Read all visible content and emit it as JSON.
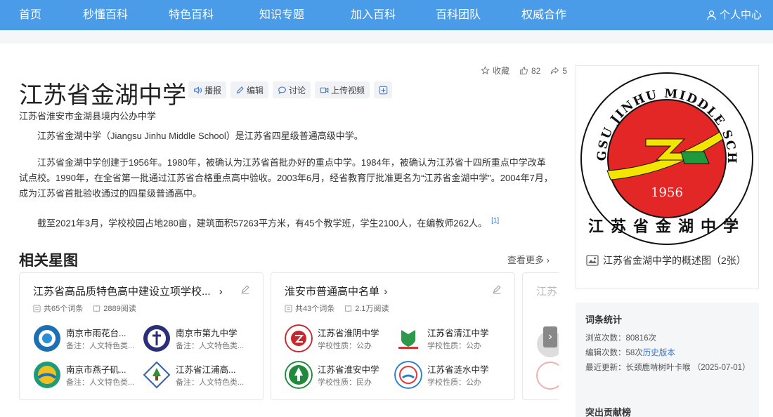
{
  "nav": {
    "items": [
      "首页",
      "秒懂百科",
      "特色百科",
      "知识专题",
      "加入百科",
      "百科团队",
      "权威合作"
    ],
    "user_center": "个人中心"
  },
  "stats": {
    "collect": "收藏",
    "likes": "82",
    "shares": "5"
  },
  "title": "江苏省金湖中学",
  "tools": {
    "broadcast": "播报",
    "edit": "编辑",
    "discuss": "讨论",
    "upload_video": "上传视频"
  },
  "subtitle": "江苏省淮安市金湖县境内公办中学",
  "paragraphs": [
    "江苏省金湖中学（Jiangsu Jinhu Middle School）是江苏省四星级普通高级中学。",
    "江苏省金湖中学创建于1956年。1980年，被确认为江苏省首批办好的重点中学。1984年，被确认为江苏省十四所重点中学改革试点校。1990年，在全省第一批通过江苏省合格重点高中验收。2003年6月，经省教育厅批准更名为“江苏省金湖中学”。2004年7月，成为江苏省首批验收通过的四星级普通高中。",
    "截至2021年3月，学校校园占地280亩，建筑面积57263平方米，有45个教学班，学生2100人，在编教师262人。"
  ],
  "citation": "[1]",
  "related": {
    "title": "相关星图",
    "more": "查看更多",
    "cards": [
      {
        "title": "江苏省高品质特色高中建设立项学校...",
        "count": "共65个词条",
        "views": "2889阅读",
        "entries": [
          {
            "name": "南京市雨花台...",
            "note": "备注：人文特色类..."
          },
          {
            "name": "南京市第九中学",
            "note": "备注：人文特色类..."
          },
          {
            "name": "南京市燕子矶...",
            "note": "备注：人文特色类..."
          },
          {
            "name": "江苏省江浦高...",
            "note": "备注：人文特色类..."
          }
        ]
      },
      {
        "title": "淮安市普通高中名单",
        "count": "共43个词条",
        "views": "2.1万阅读",
        "entries": [
          {
            "name": "江苏省淮阴中学",
            "note": "学校性质：公办"
          },
          {
            "name": "江苏省清江中学",
            "note": "学校性质：公办"
          },
          {
            "name": "江苏省淮安中学",
            "note": "学校性质：民办"
          },
          {
            "name": "江苏省涟水中学",
            "note": "学校性质：公办"
          }
        ]
      }
    ],
    "partial_card_title": "江苏"
  },
  "image": {
    "caption": "江苏省金湖中学的概述图（2张）",
    "logo_text": {
      "top": "JIANGSU JINHU MIDDLE SCHOOL",
      "year": "1956",
      "bottom": "江苏省金湖中学"
    }
  },
  "entry_stats": {
    "title": "词条统计",
    "views_label": "浏览次数：",
    "views": "80816次",
    "edits_label": "编辑次数：",
    "edits": "58次",
    "history_link": "历史版本",
    "updated_label": "最近更新：",
    "updated": "长颈鹿啃树叶卡喉 （2025-07-01）",
    "contrib_title": "突出贡献榜"
  },
  "colors": {
    "nav_bg": "#4a9be8",
    "link": "#3b73c5",
    "logo_red": "#e32626",
    "logo_yellow": "#f2e600",
    "logo_green": "#1f9a3a"
  }
}
